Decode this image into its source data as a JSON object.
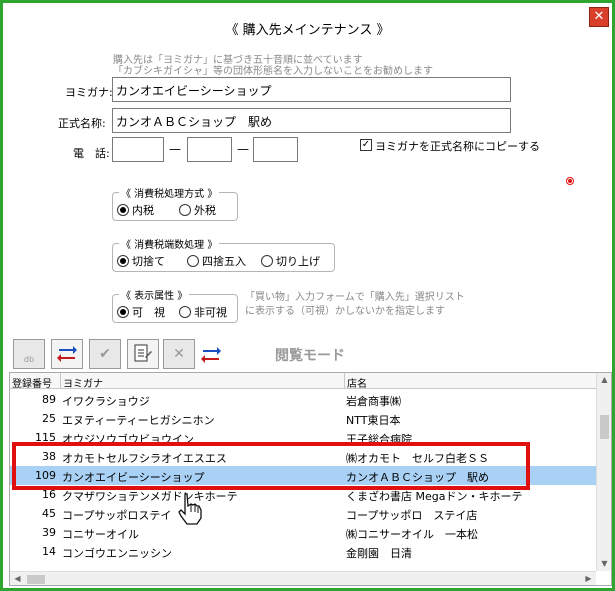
{
  "window": {
    "title": "《 購入先メインテナンス 》",
    "close_glyph": "✕"
  },
  "notes": {
    "line1": "購入先は「ヨミガナ」に基づき五十音順に並べています",
    "line2": "「カブシキガイシャ」等の団体形態名を入力しないことをお勧めします"
  },
  "form": {
    "yomigana_label": "ヨミガナ:",
    "yomigana_value": "カンオエイビーシーショップ",
    "official_label": "正式名称:",
    "official_value": "カンオＡＢＣショップ　駅め",
    "phone_label": "電　話:",
    "phone_dash": "—",
    "phone1": "",
    "phone2": "",
    "phone3": "",
    "copy_check_label": "ヨミガナを正式名称にコピーする",
    "copy_checked": "✓"
  },
  "groups": {
    "tax_method": {
      "title": "《 消費税処理方式 》",
      "options": [
        "内税",
        "外税"
      ],
      "selected": "内税"
    },
    "tax_rounding": {
      "title": "《 消費税端数処理 》",
      "options": [
        "切捨て",
        "四捨五入",
        "切り上げ"
      ],
      "selected": "切捨て"
    },
    "display": {
      "title": "《 表示属性 》",
      "options": [
        "可　視",
        "非可視"
      ],
      "selected": "可　視",
      "note_line1": "「買い物」入力フォームで「購入先」選択リスト",
      "note_line2": "に表示する（可視）かしないかを指定します"
    }
  },
  "toolbar": {
    "db_label": "db",
    "mode_label": "閲覧モード"
  },
  "table": {
    "columns": [
      "登録番号",
      "ヨミガナ",
      "店名"
    ],
    "rows": [
      {
        "no": "89",
        "kana": "イワクラショウジ",
        "name": "岩倉商事㈱"
      },
      {
        "no": "25",
        "kana": "エヌティーティーヒガシニホン",
        "name": "NTT東日本"
      },
      {
        "no": "115",
        "kana": "オウジソウゴウビョウイン",
        "name": "王子総合病院"
      },
      {
        "no": "38",
        "kana": "オカモトセルフシラオイエスエス",
        "name": "㈱オカモト　セルフ白老ＳＳ"
      },
      {
        "no": "109",
        "kana": "カンオエイビーシーショップ",
        "name": "カンオＡＢＣショップ　駅め"
      },
      {
        "no": "16",
        "kana": "クマザワショテンメガドンキホーテ",
        "name": "くまざわ書店 Megaドン・キホーテ"
      },
      {
        "no": "45",
        "kana": "コープサッポロステイ",
        "name": "コープサッポロ　ステイ店"
      },
      {
        "no": "39",
        "kana": "コニサーオイル",
        "name": "㈱コニサーオイル　一本松"
      },
      {
        "no": "14",
        "kana": "コンゴウエンニッシン",
        "name": "金剛園　日清"
      }
    ],
    "selected_index": 4
  },
  "colors": {
    "window_border": "#2ea52e",
    "selection": "#a9d1f5",
    "highlight": "#e01010"
  }
}
